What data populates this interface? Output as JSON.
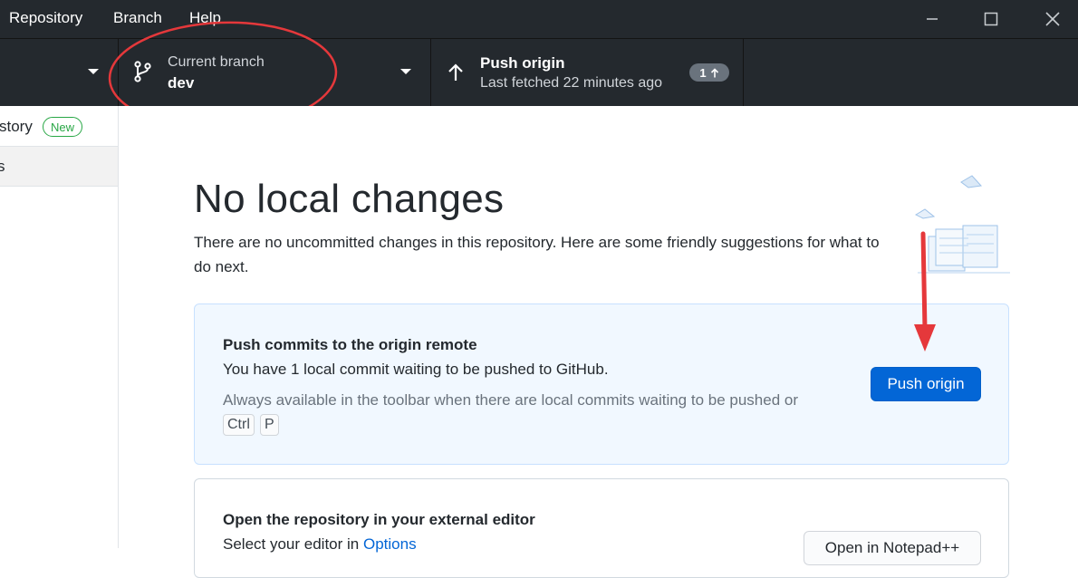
{
  "menu": {
    "items": [
      "Repository",
      "Branch",
      "Help"
    ]
  },
  "window_controls": [
    "minimize",
    "maximize",
    "close"
  ],
  "toolbar": {
    "branch": {
      "label": "Current branch",
      "value": "dev"
    },
    "push": {
      "label": "Push origin",
      "subtitle": "Last fetched 22 minutes ago",
      "ahead_count": "1"
    }
  },
  "sidebar": {
    "tabs": [
      {
        "label": "story",
        "badge": "New"
      },
      {
        "label": "s"
      }
    ]
  },
  "main": {
    "heading": "No local changes",
    "description": "There are no uncommitted changes in this repository. Here are some friendly suggestions for what to do next.",
    "push_card": {
      "title": "Push commits to the origin remote",
      "text": "You have 1 local commit waiting to be pushed to GitHub.",
      "hint": "Always available in the toolbar when there are local commits waiting to be pushed or",
      "shortcut": [
        "Ctrl",
        "P"
      ],
      "button": "Push origin"
    },
    "editor_card": {
      "title": "Open the repository in your external editor",
      "text_prefix": "Select your editor in",
      "text_link": "Options",
      "button": "Open in Notepad++"
    }
  },
  "colors": {
    "toolbar_bg": "#24292e",
    "accent": "#0366d6",
    "annotation": "#e5383b",
    "new_badge": "#28a745"
  }
}
